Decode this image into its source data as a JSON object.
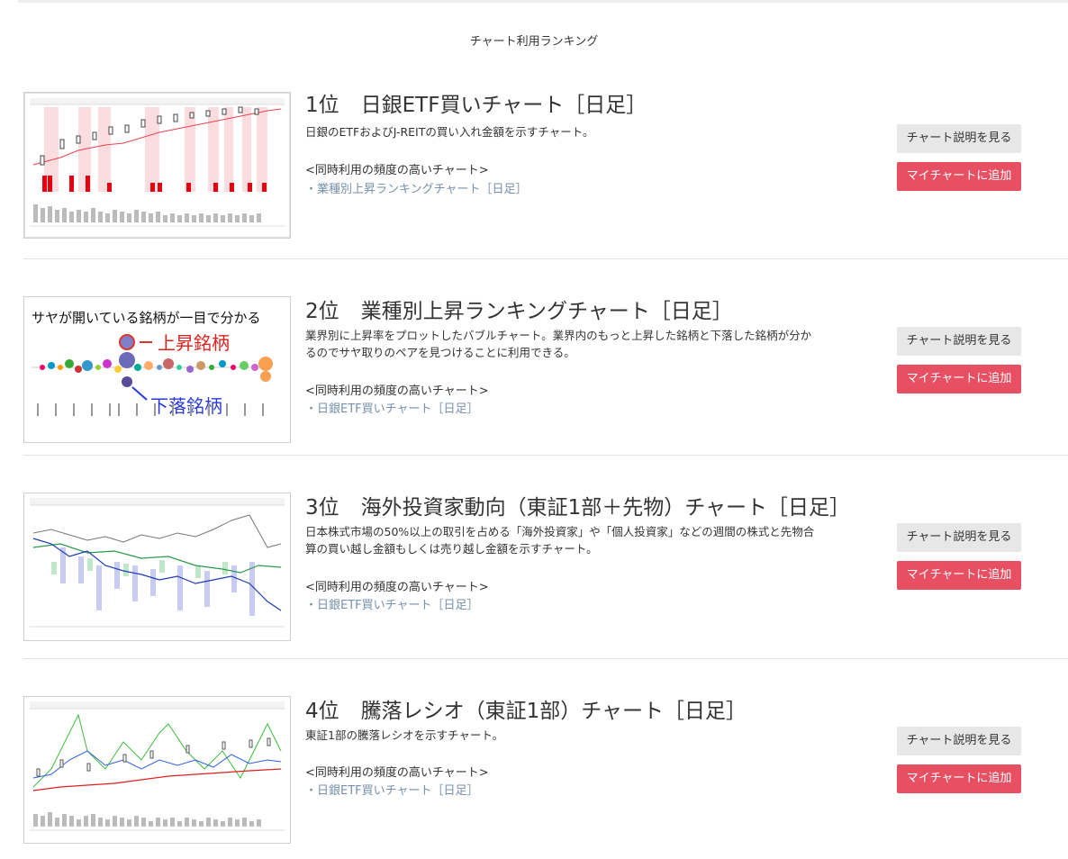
{
  "page": {
    "heading": "チャート利用ランキング"
  },
  "colors": {
    "accent_red": "#e75063",
    "link_blue": "#7590ac",
    "button_gray": "#e7e7e7"
  },
  "items": [
    {
      "rank": "1位",
      "title": "日銀ETF買いチャート［日足］",
      "description": "日銀のETFおよびJ-REITの買い入れ金額を示すチャート。",
      "related_heading": "<同時利用の頻度の高いチャート>",
      "related_link": "業種別上昇ランキングチャート［日足］",
      "explain_button": "チャート説明を見る",
      "add_button": "マイチャートに追加"
    },
    {
      "rank": "2位",
      "title": "業種別上昇ランキングチャート［日足］",
      "description": "業界別に上昇率をプロットしたバブルチャート。業界内のもっと上昇した銘柄と下落した銘柄が分かるのでサヤ取りのペアを見つけることに利用できる。",
      "related_heading": "<同時利用の頻度の高いチャート>",
      "related_link": "日銀ETF買いチャート［日足］",
      "explain_button": "チャート説明を見る",
      "add_button": "マイチャートに追加",
      "thumb_caption": "サヤが開いている銘柄が一目で分かる",
      "thumb_up_label": "上昇銘柄",
      "thumb_down_label": "下落銘柄"
    },
    {
      "rank": "3位",
      "title": "海外投資家動向（東証1部＋先物）チャート［日足］",
      "description": "日本株式市場の50%以上の取引を占める「海外投資家」や「個人投資家」などの週間の株式と先物合算の買い越し金額もしくは売り越し金額を示すチャート。",
      "related_heading": "<同時利用の頻度の高いチャート>",
      "related_link": "日銀ETF買いチャート［日足］",
      "explain_button": "チャート説明を見る",
      "add_button": "マイチャートに追加"
    },
    {
      "rank": "4位",
      "title": "騰落レシオ（東証1部）チャート［日足］",
      "description": "東証1部の騰落レシオを示すチャート。",
      "related_heading": "<同時利用の頻度の高いチャート>",
      "related_link": "日銀ETF買いチャート［日足］",
      "explain_button": "チャート説明を見る",
      "add_button": "マイチャートに追加"
    }
  ],
  "icons": {
    "thumbnail": "chart-thumbnail-image"
  }
}
